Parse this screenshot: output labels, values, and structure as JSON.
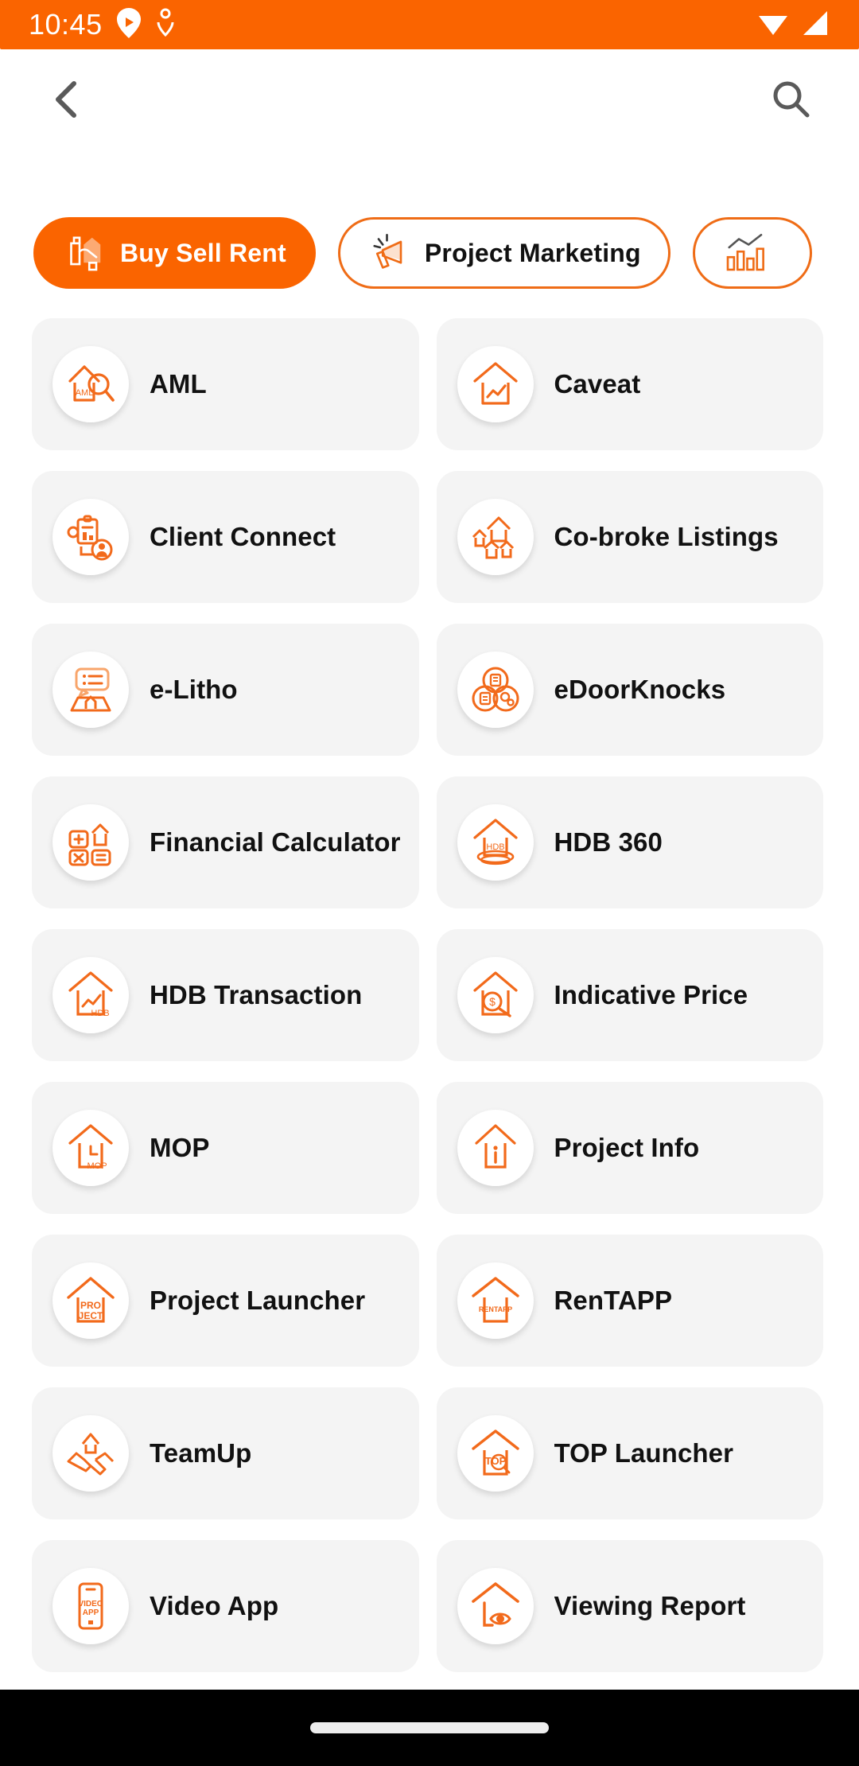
{
  "status_bar": {
    "time": "10:45",
    "background_color": "#FA6400",
    "foreground_color": "#FFFFFF",
    "left_icons": [
      "play-badge-icon",
      "location-pin-icon"
    ],
    "right_icons": [
      "wifi-icon",
      "cellular-signal-icon"
    ]
  },
  "header": {
    "back_icon": "chevron-left-icon",
    "search_icon": "search-icon",
    "icon_color": "#5A5A5A"
  },
  "tabs": {
    "accent_color": "#FA6400",
    "items": [
      {
        "label": "Buy Sell Rent",
        "icon": "house-handshake-icon",
        "active": true
      },
      {
        "label": "Project Marketing",
        "icon": "megaphone-icon",
        "active": false
      },
      {
        "label": "",
        "icon": "bar-chart-trend-icon",
        "active": false
      }
    ]
  },
  "grid": {
    "card_background": "#F4F4F4",
    "icon_color": "#F26A1B",
    "rows": [
      [
        {
          "label": "AML",
          "icon": "house-magnifier-aml-icon"
        },
        {
          "label": "Caveat",
          "icon": "house-chart-icon"
        }
      ],
      [
        {
          "label": "Client Connect",
          "icon": "clipboard-person-icon"
        },
        {
          "label": "Co-broke Listings",
          "icon": "multi-house-icon"
        }
      ],
      [
        {
          "label": "e-Litho",
          "icon": "speech-bubble-list-map-icon"
        },
        {
          "label": "eDoorKnocks",
          "icon": "three-circles-icon"
        }
      ],
      [
        {
          "label": "Financial Calculator",
          "icon": "calculator-house-icon"
        },
        {
          "label": "HDB 360",
          "icon": "house-hdb-360-icon"
        }
      ],
      [
        {
          "label": "HDB Transaction",
          "icon": "house-hdb-chart-icon"
        },
        {
          "label": "Indicative Price",
          "icon": "house-dollar-magnifier-icon"
        }
      ],
      [
        {
          "label": "MOP",
          "icon": "house-clock-mop-icon"
        },
        {
          "label": "Project Info",
          "icon": "house-info-icon"
        }
      ],
      [
        {
          "label": "Project Launcher",
          "icon": "house-project-icon"
        },
        {
          "label": "RenTAPP",
          "icon": "house-rentapp-icon"
        }
      ],
      [
        {
          "label": "TeamUp",
          "icon": "house-handshake-teamup-icon"
        },
        {
          "label": "TOP Launcher",
          "icon": "house-top-icon"
        }
      ],
      [
        {
          "label": "Video App",
          "icon": "phone-video-app-icon"
        },
        {
          "label": "Viewing Report",
          "icon": "house-eye-icon"
        }
      ]
    ]
  },
  "nav_bar": {
    "background_color": "#000000",
    "handle_label": "gesture-home-handle"
  }
}
